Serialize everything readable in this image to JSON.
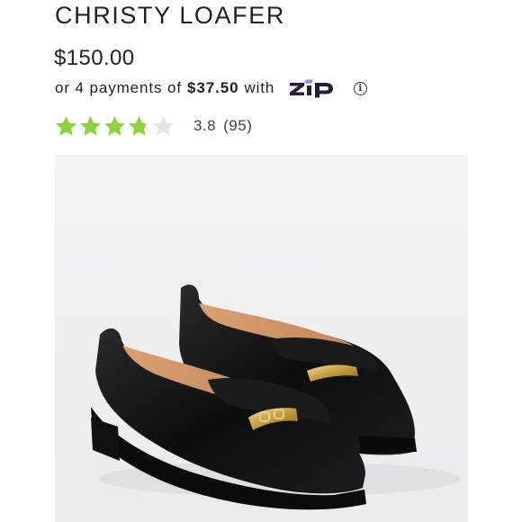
{
  "product": {
    "title": "CHRISTY LOAFER",
    "price": "$150.00"
  },
  "installments": {
    "prefix": "or 4 payments of",
    "amount": "$37.50",
    "suffix": "with",
    "provider_logo": "zip-logo",
    "info_icon": "info-icon"
  },
  "rating": {
    "value": "3.8",
    "count": "(95)",
    "stars_filled": 3.8,
    "stars_total": 5,
    "star_color": "#8ed23c",
    "star_empty_color": "#e6e6e6"
  },
  "image": {
    "background": "#f1f1f2",
    "subject": "pair of black leather loafers with gold chain hardware"
  },
  "colors": {
    "zip_purple": "#2a1a3d",
    "zip_accent": "#9a86e6"
  }
}
